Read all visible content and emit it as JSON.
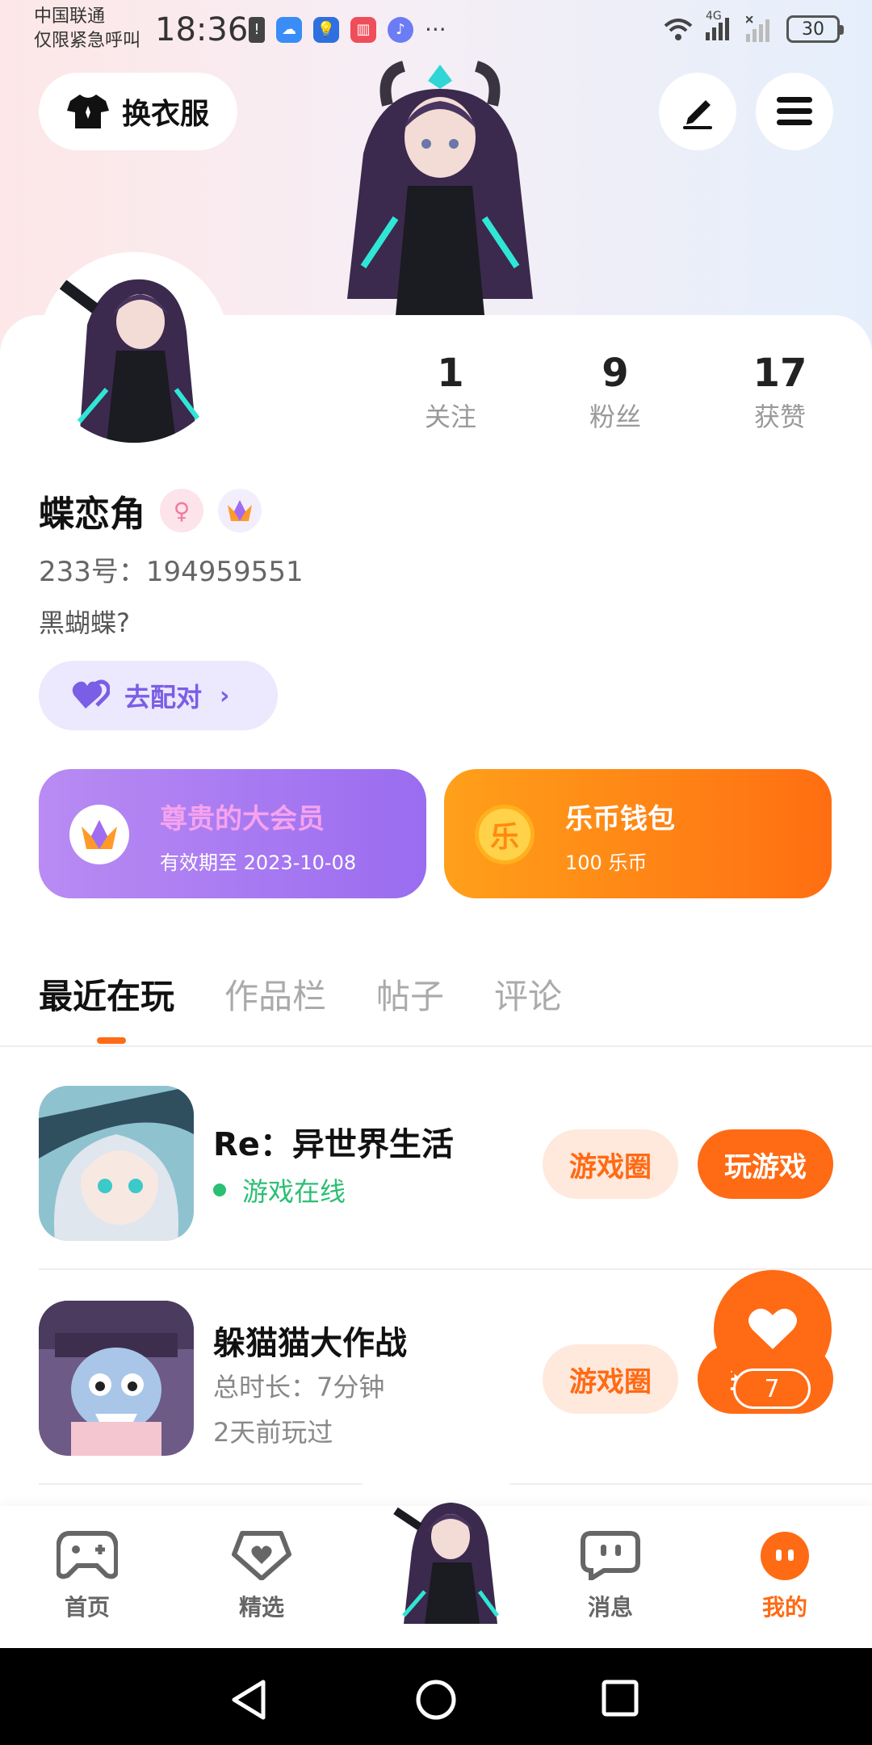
{
  "status_bar": {
    "carrier_line1": "中国联通",
    "carrier_line2": "仅限紧急呼叫",
    "time": "18:36",
    "more": "···",
    "network": "4G",
    "battery": "30"
  },
  "header": {
    "outfit_label": "换衣服"
  },
  "profile": {
    "stats": [
      {
        "value": "1",
        "label": "关注"
      },
      {
        "value": "9",
        "label": "粉丝"
      },
      {
        "value": "17",
        "label": "获赞"
      }
    ],
    "nickname": "蝶恋角",
    "uid": "233号：194959551",
    "bio": "黑蝴蝶?",
    "match_label": "去配对"
  },
  "vip_card": {
    "title": "尊贵的大会员",
    "subtitle": "有效期至 2023-10-08"
  },
  "wallet_card": {
    "icon_char": "乐",
    "title": "乐币钱包",
    "subtitle": "100 乐币"
  },
  "tabs": [
    {
      "label": "最近在玩",
      "active": true
    },
    {
      "label": "作品栏",
      "active": false
    },
    {
      "label": "帖子",
      "active": false
    },
    {
      "label": "评论",
      "active": false
    }
  ],
  "games": [
    {
      "title": "Re：异世界生活",
      "status": "游戏在线",
      "circle_label": "游戏圈",
      "play_label": "玩游戏"
    },
    {
      "title": "躲猫猫大作战",
      "duration": "总时长：7分钟",
      "last_played": "2天前玩过",
      "circle_label": "游戏圈",
      "play_label": "玩"
    }
  ],
  "favorite": {
    "count": "7"
  },
  "bottom_nav": [
    {
      "label": "首页",
      "icon": "gamepad-icon"
    },
    {
      "label": "精选",
      "icon": "heart-shield-icon"
    },
    {
      "label": "消息",
      "icon": "chat-icon"
    },
    {
      "label": "我的",
      "icon": "profile-face-icon",
      "active": true
    }
  ],
  "colors": {
    "accent": "#ff6a14",
    "vip_purple": "#9a6cf0",
    "match_purple": "#7a5ee6",
    "online_green": "#2bbf74"
  }
}
